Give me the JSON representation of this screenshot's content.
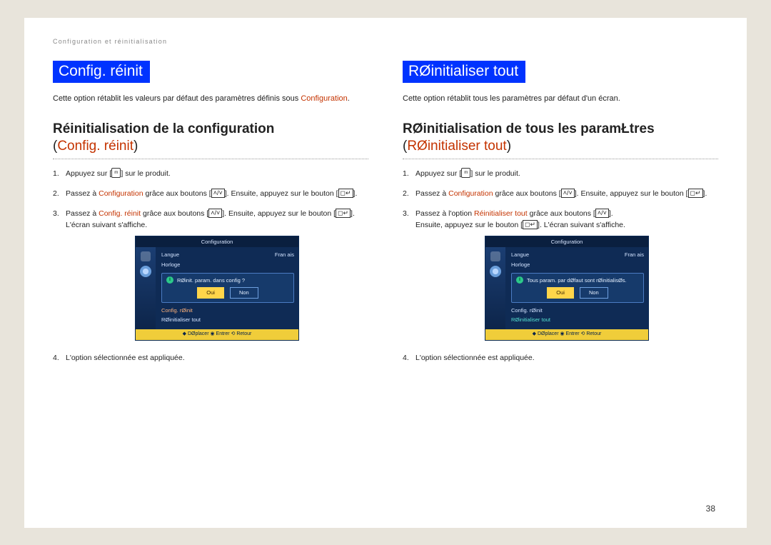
{
  "header_path": "Configuration et réinitialisation",
  "page_number": "38",
  "left": {
    "title": "Config. réinit",
    "intro_pre": "Cette option rétablit les valeurs par défaut des paramètres définis sous ",
    "intro_hl": "Configuration",
    "intro_post": ".",
    "section_head": "Réinitialisation de la configuration",
    "section_sub_open": "(",
    "section_sub_hl": "Config. réinit",
    "section_sub_close": ")",
    "steps": {
      "s1_a": "Appuyez sur [",
      "s1_icon": "ᵐ",
      "s1_b": "] sur le produit.",
      "s2_a": "Passez à ",
      "s2_hl": "Configuration",
      "s2_b": " grâce aux boutons [",
      "s2_icon": "˄/˅",
      "s2_c": "]. Ensuite, appuyez sur le bouton [",
      "s2_icon2": "◻↵",
      "s2_d": "].",
      "s3_a": "Passez à ",
      "s3_hl": "Config. réinit",
      "s3_b": " grâce aux boutons [",
      "s3_icon": "˄/˅",
      "s3_c": "]. Ensuite, appuyez sur le bouton [",
      "s3_icon2": "◻↵",
      "s3_d": "]. L'écran suivant s'affiche.",
      "s4": "L'option sélectionnée est appliquée."
    },
    "osd": {
      "top": "Configuration",
      "row1_lab": "Langue",
      "row1_val": "Fran ais",
      "row2_lab": "Horloge",
      "dlg_msg": "RØinit. param. dans config ?",
      "btn_yes": "Oui",
      "btn_no": "Non",
      "link1": "Config. rØinit",
      "link2": "RØinitialiser tout",
      "footer": "◆ DØplacer   ◉ Entrer   ⟲ Retour"
    }
  },
  "right": {
    "title": "RØinitialiser tout",
    "intro": "Cette option rétablit tous les paramètres par défaut d'un écran.",
    "section_head": "RØinitialisation de tous les paramŁtres",
    "section_sub_open": "(",
    "section_sub_hl": "RØinitialiser tout",
    "section_sub_close": ")",
    "steps": {
      "s1_a": "Appuyez sur [",
      "s1_icon": "ᵐ",
      "s1_b": "] sur le produit.",
      "s2_a": "Passez à ",
      "s2_hl": "Configuration",
      "s2_b": " grâce aux boutons [",
      "s2_icon": "˄/˅",
      "s2_c": "]. Ensuite, appuyez sur le bouton [",
      "s2_icon2": "◻↵",
      "s2_d": "].",
      "s3_a": "Passez à l'option ",
      "s3_hl": "Réinitialiser tout",
      "s3_b": " grâce aux boutons [",
      "s3_icon": "˄/˅",
      "s3_c": "].",
      "s3_line2_a": "Ensuite, appuyez sur le bouton [",
      "s3_line2_icon": "◻↵",
      "s3_line2_b": "]. L'écran suivant s'affiche.",
      "s4": "L'option sélectionnée est appliquée."
    },
    "osd": {
      "top": "Configuration",
      "row1_lab": "Langue",
      "row1_val": "Fran ais",
      "row2_lab": "Horloge",
      "dlg_msg": "Tous param. par dØfaut sont rØinitialisØs.",
      "btn_yes": "Oui",
      "btn_no": "Non",
      "link1": "Config. rØinit",
      "link2": "RØinitialiser tout",
      "footer": "◆ DØplacer   ◉ Entrer   ⟲ Retour"
    }
  }
}
